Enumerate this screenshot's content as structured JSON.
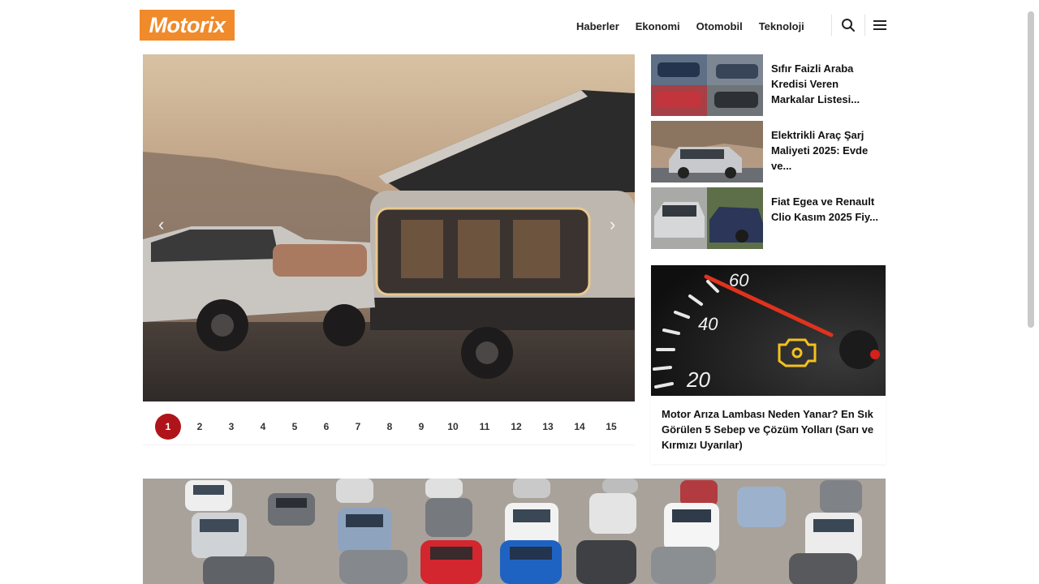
{
  "header": {
    "logo": "Motorix",
    "nav": [
      "Haberler",
      "Ekonomi",
      "Otomobil",
      "Teknoloji"
    ],
    "search_icon": "search-icon",
    "menu_icon": "menu-icon"
  },
  "hero": {
    "prev": "‹",
    "next": "›",
    "pages": [
      "1",
      "2",
      "3",
      "4",
      "5",
      "6",
      "7",
      "8",
      "9",
      "10",
      "11",
      "12",
      "13",
      "14",
      "15"
    ],
    "active_page": "1"
  },
  "side": [
    {
      "title": "Sıfır Faizli Araba Kredisi Veren Markalar Listesi..."
    },
    {
      "title": "Elektrikli Araç Şarj Maliyeti 2025: Evde ve..."
    },
    {
      "title": "Fiat Egea ve Renault Clio Kasım 2025 Fiy..."
    }
  ],
  "feature": {
    "gauge_labels": [
      "60",
      "40",
      "20"
    ],
    "title": "Motor Arıza Lambası Neden Yanar? En Sık Görülen 5 Sebep ve Çözüm Yolları (Sarı ve Kırmızı Uyarılar)"
  },
  "colors": {
    "brand": "#f08a2a",
    "active": "#b0141b"
  }
}
